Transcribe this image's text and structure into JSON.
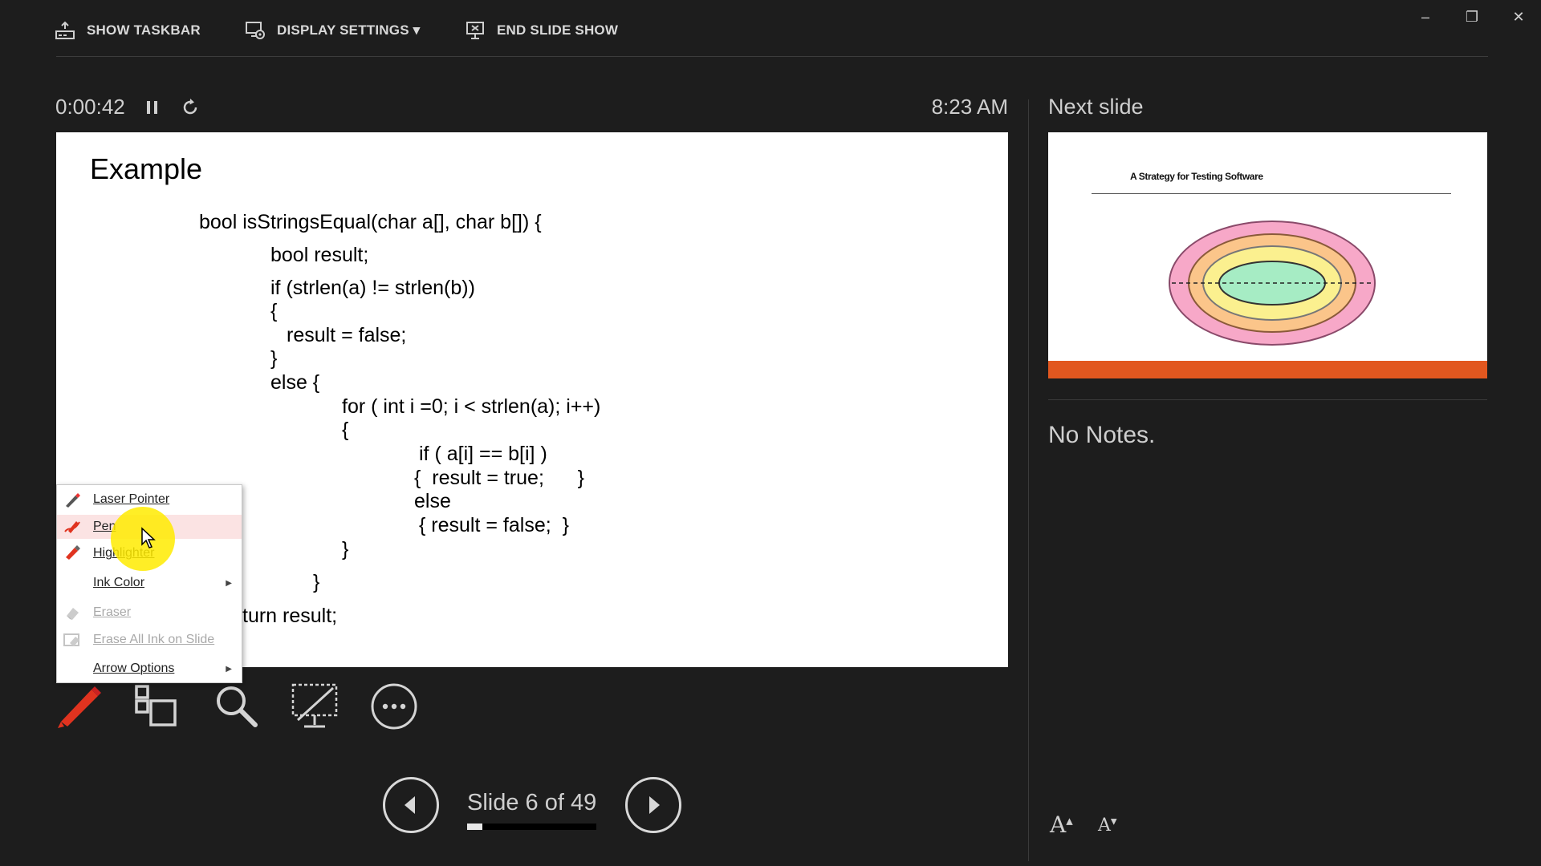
{
  "toolbar": {
    "show_taskbar": "SHOW TASKBAR",
    "display_settings": "DISPLAY SETTINGS ▾",
    "end_slide_show": "END SLIDE SHOW",
    "icons": [
      "taskbar-icon",
      "display-settings-icon",
      "end-show-icon"
    ]
  },
  "window": {
    "minimize": "–",
    "restore": "❐",
    "close": "✕"
  },
  "presenter": {
    "timer": "0:00:42",
    "clock": "8:23 AM",
    "next_slide_label": "Next slide",
    "notes": "No Notes.",
    "slide_counter": "Slide 6 of 49",
    "progress": 0.12
  },
  "current_slide": {
    "title": "Example",
    "code": [
      "bool isStringsEqual(char a[], char b[]) {",
      "bool result;",
      "if (strlen(a) != strlen(b))",
      "{",
      "result = false;",
      "}",
      "else {",
      "for ( int i =0; i < strlen(a); i++)",
      "{",
      "if ( a[i] == b[i] )",
      "{  result = true;      }",
      "else",
      "{ result = false;  }",
      "}",
      "}",
      "turn result;"
    ]
  },
  "next_slide": {
    "title": "A Strategy for Testing Software",
    "colors": {
      "outer": "#f7a8c8",
      "middle": "#fbc58a",
      "inner": "#fbf08f",
      "core": "#a6ecc4",
      "bar": "#e2571f"
    }
  },
  "context_menu": {
    "items": [
      {
        "label": "Laser Pointer",
        "icon": "laser-pointer-icon",
        "disabled": false
      },
      {
        "label": "Pen",
        "icon": "pen-icon",
        "disabled": false
      },
      {
        "label": "Highlighter",
        "icon": "highlighter-icon",
        "disabled": false
      },
      {
        "label": "Ink Color",
        "icon": "",
        "disabled": false,
        "submenu": true
      },
      {
        "label": "Eraser",
        "icon": "eraser-icon",
        "disabled": true
      },
      {
        "label": "Erase All Ink on Slide",
        "icon": "erase-all-icon",
        "disabled": true
      },
      {
        "label": "Arrow Options",
        "icon": "",
        "disabled": false,
        "submenu": true
      }
    ]
  },
  "tools": [
    "pen-tool-icon",
    "slide-sorter-icon",
    "zoom-icon",
    "black-screen-icon",
    "more-options-icon"
  ],
  "font_controls": {
    "increase": "A",
    "decrease": "A"
  },
  "colors": {
    "background": "#1d1d1d",
    "accent": "#e2571f",
    "pen": "#e0331f",
    "highlight": "#fbe3e3"
  }
}
